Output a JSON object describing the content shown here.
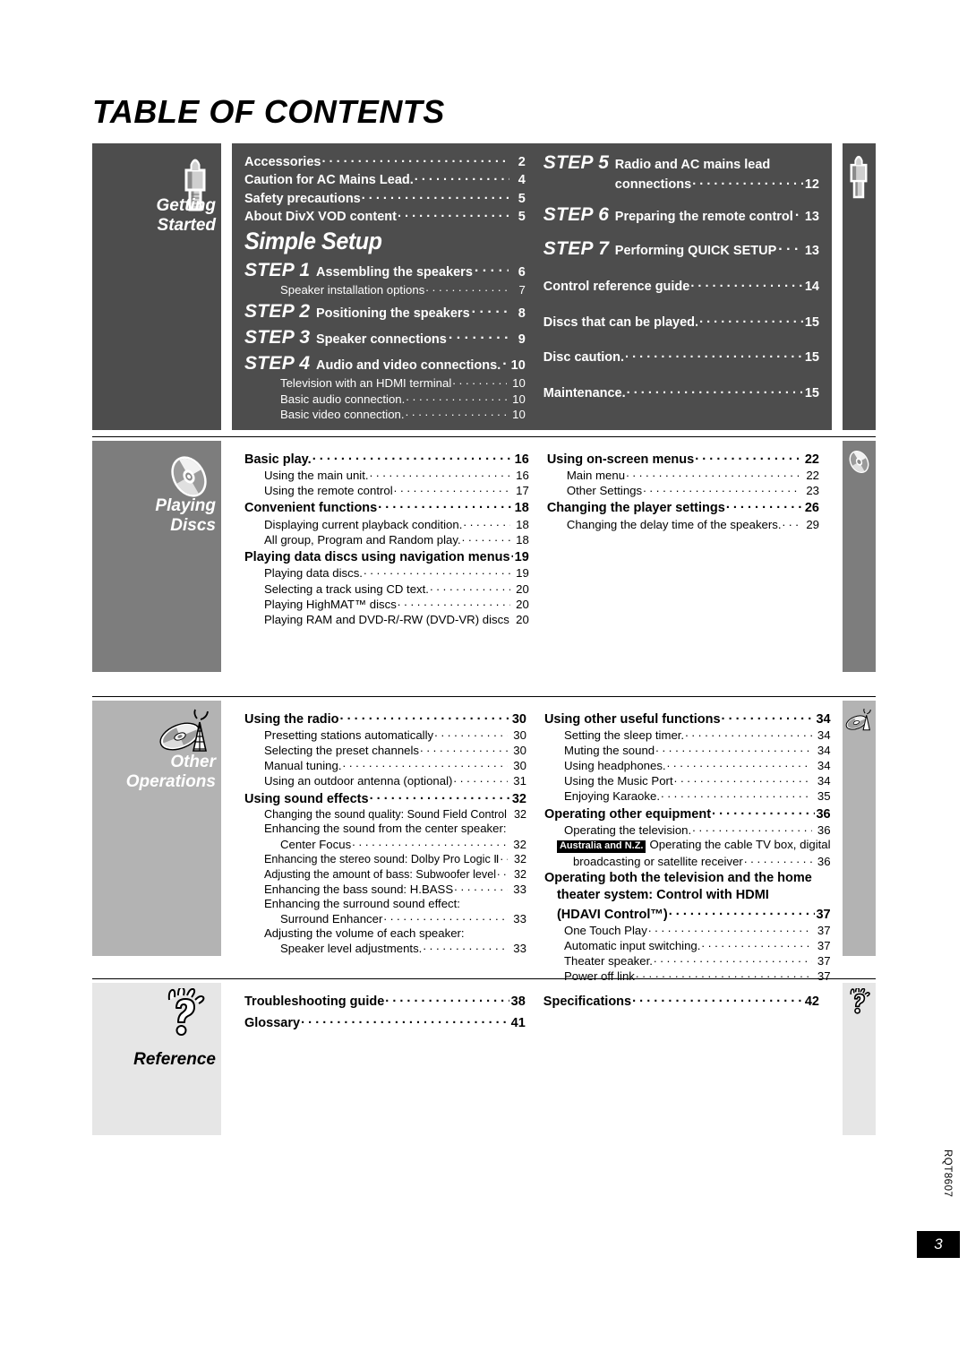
{
  "page_title": "TABLE OF CONTENTS",
  "footer": {
    "doc_code": "RQT8607",
    "page_number": "3"
  },
  "sections": [
    {
      "id": "getting-started",
      "label_line1": "Getting",
      "label_line2": "Started",
      "icon": "audio-plug-icon",
      "simple_setup_logo": "Simple Setup",
      "left_rows": [
        {
          "level": 1,
          "label": "Accessories",
          "page": "2"
        },
        {
          "level": 1,
          "label": "Caution for AC Mains Lead.",
          "page": "4"
        },
        {
          "level": 1,
          "label": "Safety precautions",
          "page": "5"
        },
        {
          "level": 1,
          "label": "About DivX VOD content",
          "page": "5"
        },
        {
          "level": "logo"
        },
        {
          "level": "step",
          "step": "STEP 1",
          "label": "Assembling the speakers",
          "page": "6"
        },
        {
          "level": 3,
          "label": "Speaker installation options",
          "page": "7"
        },
        {
          "level": "step",
          "step": "STEP 2",
          "label": "Positioning the speakers",
          "page": "8"
        },
        {
          "level": "step",
          "step": "STEP 3",
          "label": "Speaker connections",
          "page": "9"
        },
        {
          "level": "step",
          "step": "STEP 4",
          "label": "Audio and video connections.",
          "page": "10"
        },
        {
          "level": 3,
          "label": "Television with an HDMI terminal",
          "page": "10"
        },
        {
          "level": 3,
          "label": "Basic audio connection.",
          "page": "10"
        },
        {
          "level": 3,
          "label": "Basic video connection.",
          "page": "10"
        }
      ],
      "right_rows": [
        {
          "level": "step2",
          "step": "STEP 5",
          "label": "Radio and AC mains lead"
        },
        {
          "level": "cont",
          "label": "connections",
          "page": "12"
        },
        {
          "level": "step",
          "step": "STEP 6",
          "label": "Preparing the remote control",
          "page": "13"
        },
        {
          "level": "step",
          "step": "STEP 7",
          "label": "Performing QUICK SETUP",
          "page": "13"
        },
        {
          "level": "gap"
        },
        {
          "level": 1,
          "label": "Control reference guide",
          "page": "14"
        },
        {
          "level": "gap"
        },
        {
          "level": 1,
          "label": "Discs that can be played.",
          "page": "15"
        },
        {
          "level": "gap"
        },
        {
          "level": 1,
          "label": "Disc caution.",
          "page": "15"
        },
        {
          "level": "gap"
        },
        {
          "level": 1,
          "label": "Maintenance.",
          "page": "15"
        }
      ]
    },
    {
      "id": "playing-discs",
      "label_line1": "Playing",
      "label_line2": "Discs",
      "icon": "disc-icon",
      "left_rows": [
        {
          "level": 1,
          "label": "Basic play.",
          "page": "16"
        },
        {
          "level": 2,
          "label": "Using the main unit.",
          "page": "16"
        },
        {
          "level": 2,
          "label": "Using the remote control",
          "page": "17"
        },
        {
          "level": 1,
          "label": "Convenient functions",
          "page": "18"
        },
        {
          "level": 2,
          "label": "Displaying current playback condition.",
          "page": "18"
        },
        {
          "level": 2,
          "label": "All group, Program and Random play.",
          "page": "18"
        },
        {
          "level": 1,
          "label": "Playing data discs using navigation menus",
          "page": "19"
        },
        {
          "level": 2,
          "label": "Playing data discs.",
          "page": "19"
        },
        {
          "level": 2,
          "label": "Selecting a track using CD text.",
          "page": "20"
        },
        {
          "level": 2,
          "label": "Playing HighMAT™ discs",
          "page": "20"
        },
        {
          "level": 2,
          "label": "Playing RAM and DVD-R/-RW (DVD-VR) discs",
          "page": "20"
        }
      ],
      "right_rows": [
        {
          "level": 1,
          "label": "Using on-screen menus",
          "page": "22"
        },
        {
          "level": 2,
          "label": "Main menu",
          "page": "22"
        },
        {
          "level": 2,
          "label": "Other Settings",
          "page": "23"
        },
        {
          "level": 1,
          "label": "Changing the player settings",
          "page": "26"
        },
        {
          "level": 2,
          "label": "Changing the delay time of the speakers.",
          "page": "29"
        }
      ]
    },
    {
      "id": "other-operations",
      "label_line1": "Other",
      "label_line2": "Operations",
      "icon": "disc-and-antenna-icon",
      "left_rows": [
        {
          "level": 1,
          "label": "Using the radio",
          "page": "30"
        },
        {
          "level": 2,
          "label": "Presetting stations automatically",
          "page": "30"
        },
        {
          "level": 2,
          "label": "Selecting the preset channels",
          "page": "30"
        },
        {
          "level": 2,
          "label": "Manual tuning.",
          "page": "30"
        },
        {
          "level": 2,
          "label": "Using an outdoor antenna (optional)",
          "page": "31"
        },
        {
          "level": 1,
          "label": "Using sound effects",
          "page": "32"
        },
        {
          "level": 2,
          "label": "Changing the sound quality: Sound Field Control",
          "page": "32"
        },
        {
          "level": "text2",
          "label": "Enhancing the sound from the center speaker:"
        },
        {
          "level": 3,
          "label": "Center Focus",
          "page": "32"
        },
        {
          "level": 2,
          "label": "Enhancing the stereo sound: Dolby Pro Logic Ⅱ",
          "page": "32"
        },
        {
          "level": 2,
          "label": "Adjusting the amount of bass: Subwoofer level",
          "page": "32"
        },
        {
          "level": 2,
          "label": "Enhancing the bass sound: H.BASS",
          "page": "33"
        },
        {
          "level": "text2",
          "label": "Enhancing the surround sound effect:"
        },
        {
          "level": 3,
          "label": "Surround Enhancer",
          "page": "33"
        },
        {
          "level": "text2",
          "label": "Adjusting the volume of each speaker:"
        },
        {
          "level": 3,
          "label": "Speaker level adjustments.",
          "page": "33"
        }
      ],
      "right_rows": [
        {
          "level": 1,
          "label": "Using other useful functions",
          "page": "34"
        },
        {
          "level": 2,
          "label": "Setting the sleep timer.",
          "page": "34"
        },
        {
          "level": 2,
          "label": "Muting the sound",
          "page": "34"
        },
        {
          "level": 2,
          "label": "Using headphones.",
          "page": "34"
        },
        {
          "level": 2,
          "label": "Using the Music Port",
          "page": "34"
        },
        {
          "level": 2,
          "label": "Enjoying Karaoke.",
          "page": "35"
        },
        {
          "level": 1,
          "label": "Operating other equipment",
          "page": "36"
        },
        {
          "level": 2,
          "label": "Operating the television.",
          "page": "36"
        },
        {
          "level": "badge",
          "badge": "Australia and N.Z.",
          "label": "Operating the cable TV box, digital"
        },
        {
          "level": 3,
          "label": "broadcasting or satellite receiver",
          "page": "36"
        },
        {
          "level": "text1",
          "label": "Operating both the television and the home"
        },
        {
          "level": "text1b",
          "label": "theater system: Control with HDMI"
        },
        {
          "level": "hdavi",
          "label": "(HDAVI Control™)",
          "page": "37"
        },
        {
          "level": 2,
          "label": "One Touch Play",
          "page": "37"
        },
        {
          "level": 2,
          "label": "Automatic input switching.",
          "page": "37"
        },
        {
          "level": 2,
          "label": "Theater speaker.",
          "page": "37"
        },
        {
          "level": 2,
          "label": "Power off link",
          "page": "37"
        }
      ]
    },
    {
      "id": "reference",
      "label_line1": "Reference",
      "label_line2": "",
      "icon": "question-mark-bulb-icon",
      "left_rows": [
        {
          "level": 1,
          "label": "Troubleshooting guide",
          "page": "38"
        },
        {
          "level": 1,
          "label": "Glossary",
          "page": "41"
        }
      ],
      "right_rows": [
        {
          "level": 1,
          "label": "Specifications",
          "page": "42"
        }
      ]
    }
  ]
}
